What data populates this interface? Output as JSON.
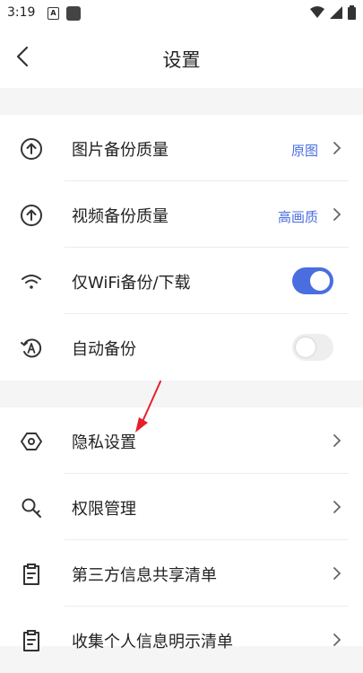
{
  "status_bar": {
    "time": "3:19",
    "notif_a": "A"
  },
  "header": {
    "title": "设置"
  },
  "group1": [
    {
      "label": "图片备份质量",
      "value": "原图",
      "icon": "upload-circle-icon"
    },
    {
      "label": "视频备份质量",
      "value": "高画质",
      "icon": "upload-circle-icon"
    },
    {
      "label": "仅WiFi备份/下载",
      "toggle": true,
      "icon": "wifi-icon"
    },
    {
      "label": "自动备份",
      "toggle": false,
      "icon": "auto-backup-icon"
    }
  ],
  "group2": [
    {
      "label": "隐私设置",
      "icon": "privacy-icon"
    },
    {
      "label": "权限管理",
      "icon": "key-icon"
    },
    {
      "label": "第三方信息共享清单",
      "icon": "clipboard-icon"
    },
    {
      "label": "收集个人信息明示清单",
      "icon": "clipboard-icon"
    }
  ],
  "colors": {
    "accent": "#4a6ee0",
    "arrow": "#e5202c",
    "background": "#f5f5f5"
  }
}
